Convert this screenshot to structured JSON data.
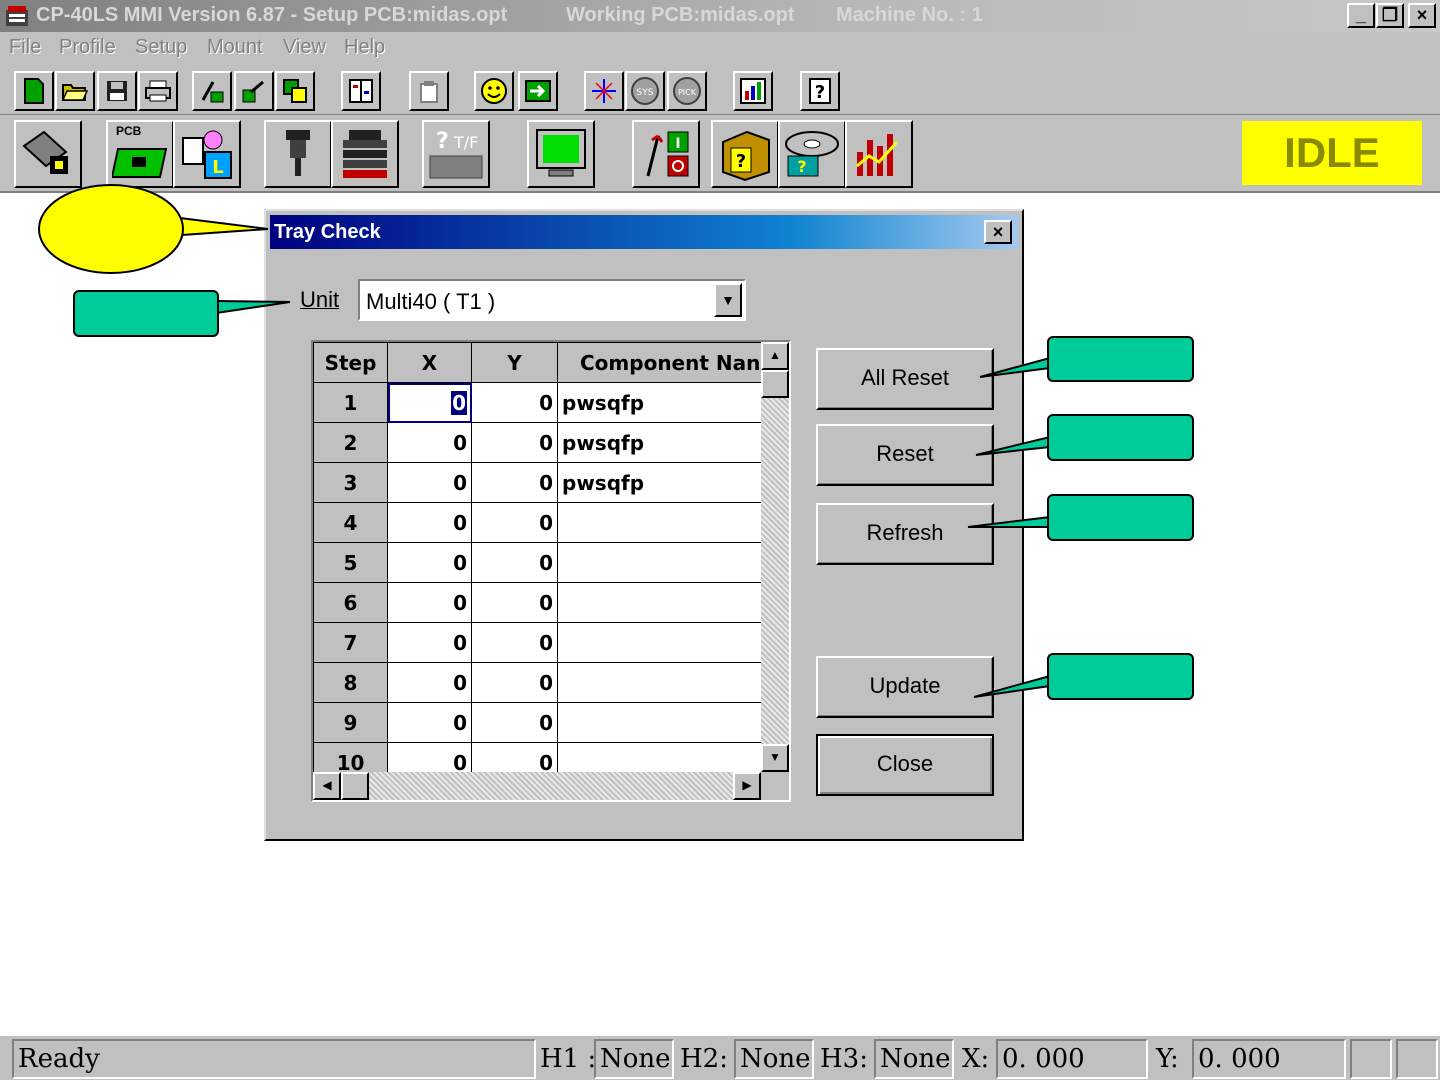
{
  "window": {
    "title_app": "CP-40LS MMI Version 6.87 - Setup PCB:midas.opt",
    "title_working": "Working PCB:midas.opt",
    "title_machine": "Machine No. : 1",
    "minimize": "_",
    "restore": "❐",
    "close": "×"
  },
  "menu": {
    "file": "File",
    "profile": "Profile",
    "setup": "Setup",
    "mount": "Mount",
    "view": "View",
    "help": "Help"
  },
  "toolbar2": {
    "status": "IDLE",
    "pcb_label": "PCB"
  },
  "dialog": {
    "title": "Tray Check",
    "close": "×",
    "unit_label": "Unit",
    "unit_value": "Multi40 ( T1 )",
    "columns": [
      "Step",
      "X",
      "Y",
      "Component Nan"
    ],
    "rows": [
      {
        "step": "1",
        "x": "0",
        "y": "0",
        "name": "pwsqfp"
      },
      {
        "step": "2",
        "x": "0",
        "y": "0",
        "name": "pwsqfp"
      },
      {
        "step": "3",
        "x": "0",
        "y": "0",
        "name": "pwsqfp"
      },
      {
        "step": "4",
        "x": "0",
        "y": "0",
        "name": ""
      },
      {
        "step": "5",
        "x": "0",
        "y": "0",
        "name": ""
      },
      {
        "step": "6",
        "x": "0",
        "y": "0",
        "name": ""
      },
      {
        "step": "7",
        "x": "0",
        "y": "0",
        "name": ""
      },
      {
        "step": "8",
        "x": "0",
        "y": "0",
        "name": ""
      },
      {
        "step": "9",
        "x": "0",
        "y": "0",
        "name": ""
      },
      {
        "step": "10",
        "x": "0",
        "y": "0",
        "name": ""
      }
    ],
    "buttons": {
      "all_reset": "All Reset",
      "reset": "Reset",
      "refresh": "Refresh",
      "update": "Update",
      "close": "Close"
    }
  },
  "statusbar": {
    "ready": "Ready",
    "h1_label": "H1 :",
    "h1_value": "None",
    "h2_label": "H2:",
    "h2_value": "None",
    "h3_label": "H3:",
    "h3_value": "None",
    "x_label": "X:",
    "x_value": "0. 000",
    "y_label": "Y:",
    "y_value": "0. 000"
  },
  "colors": {
    "callout_green": "#00cc99",
    "callout_yellow": "#ffff00",
    "title_blue": "#000080",
    "idle_bg": "#ffff00"
  }
}
